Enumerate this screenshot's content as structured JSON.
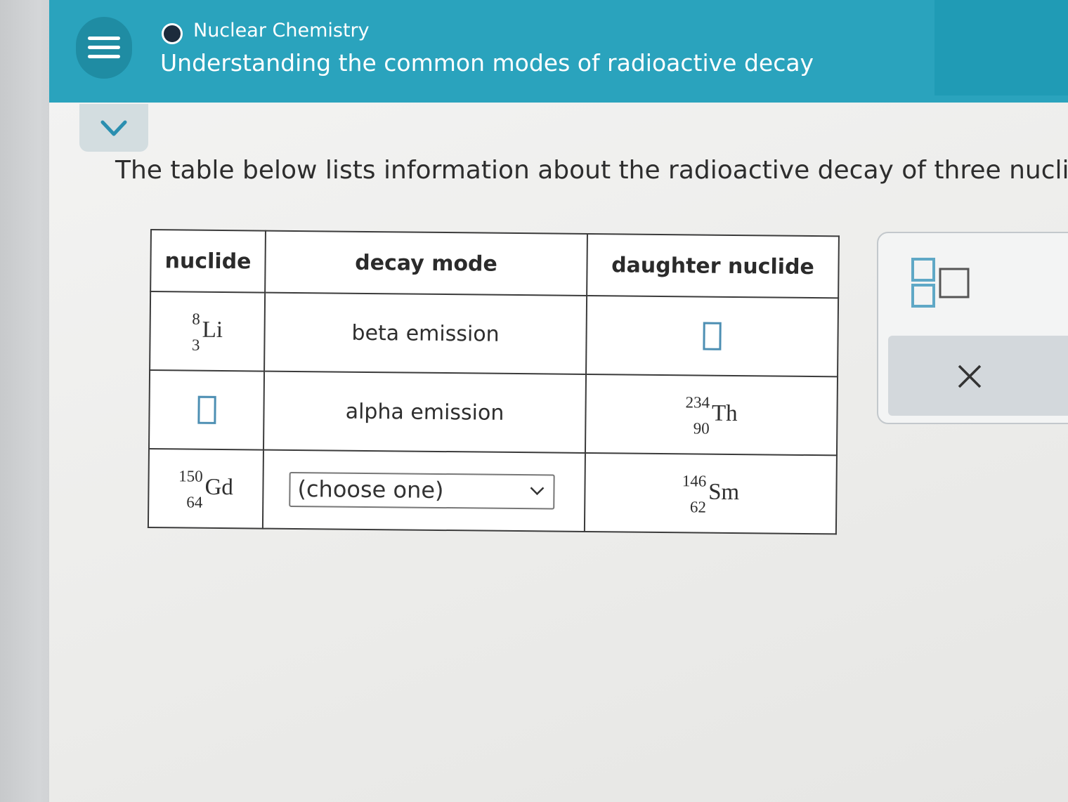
{
  "header": {
    "topic": "Nuclear Chemistry",
    "lesson_title": "Understanding the common modes of radioactive decay"
  },
  "prompt": "The table below lists information about the radioactive decay of three nuclide",
  "table": {
    "headers": [
      "nuclide",
      "decay mode",
      "daughter nuclide"
    ],
    "rows": [
      {
        "nuclide": {
          "mass": "8",
          "atomic": "3",
          "symbol": "Li"
        },
        "decay_mode": "beta emission",
        "daughter": {
          "blank": true
        }
      },
      {
        "nuclide": {
          "blank": true
        },
        "decay_mode": "alpha emission",
        "daughter": {
          "mass": "234",
          "atomic": "90",
          "symbol": "Th"
        }
      },
      {
        "nuclide": {
          "mass": "150",
          "atomic": "64",
          "symbol": "Gd"
        },
        "decay_mode_select": {
          "value": "(choose one)"
        },
        "daughter": {
          "mass": "146",
          "atomic": "62",
          "symbol": "Sm"
        }
      }
    ]
  },
  "icons": {
    "menu": "hamburger-menu-icon",
    "collapse": "chevron-down-icon",
    "template": "superscript-subscript-template-icon",
    "clear": "close-x-icon",
    "topic_dot": "topic-status-dot-icon",
    "select_caret": "chevron-down-icon"
  },
  "colors": {
    "header": "#2aa3bd",
    "header_dark": "#1f8ca3",
    "answer_box": "#4d8fb3",
    "template_icon": "#5fa8c6"
  }
}
